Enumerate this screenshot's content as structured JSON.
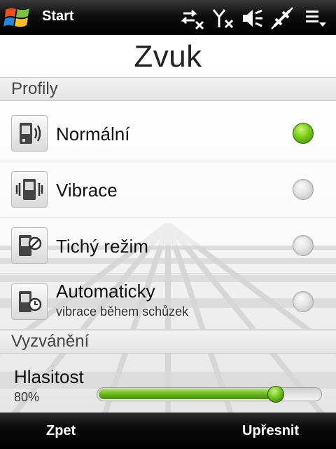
{
  "statusbar": {
    "start_label": "Start",
    "icons": [
      "data-sync-disconnected-icon",
      "signal-off-icon",
      "speaker-muted-icon",
      "bluetooth-disabled-icon",
      "menu-icon"
    ]
  },
  "page": {
    "title": "Zvuk"
  },
  "profiles": {
    "header": "Profily",
    "items": [
      {
        "label": "Normální",
        "sublabel": "",
        "icon": "phone-sound-icon",
        "selected": true
      },
      {
        "label": "Vibrace",
        "sublabel": "",
        "icon": "phone-vibrate-icon",
        "selected": false
      },
      {
        "label": "Tichý režim",
        "sublabel": "",
        "icon": "phone-silent-icon",
        "selected": false
      },
      {
        "label": "Automaticky",
        "sublabel": "vibrace během schůzek",
        "icon": "phone-clock-icon",
        "selected": false
      }
    ]
  },
  "ringtone": {
    "header": "Vyzvánění",
    "volume_label": "Hlasitost",
    "volume_value": "80%",
    "volume_level": 0.8
  },
  "softkeys": {
    "left": "Zpet",
    "right": "Upřesnit"
  },
  "colors": {
    "accent_green": "#7fd21c",
    "bar_black": "#000000"
  }
}
